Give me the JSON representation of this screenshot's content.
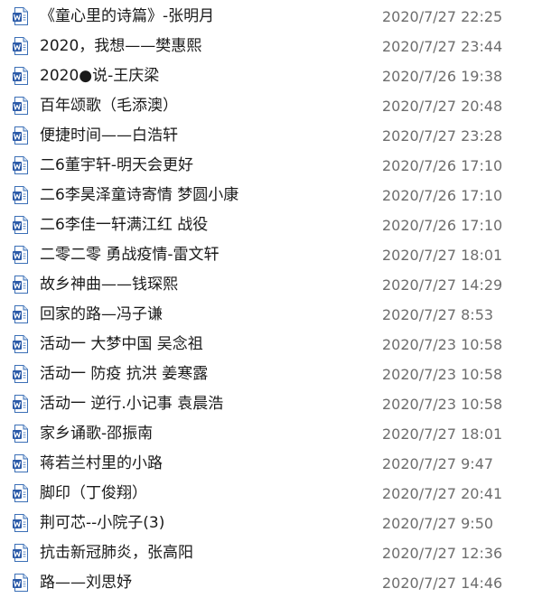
{
  "files": [
    {
      "name": "《童心里的诗篇》-张明月",
      "modified": "2020/7/27 22:25",
      "icon": "word-document-icon"
    },
    {
      "name": "2020，我想——樊惠熙",
      "modified": "2020/7/27 23:44",
      "icon": "word-document-icon"
    },
    {
      "name": "2020●说-王庆梁",
      "modified": "2020/7/26 19:38",
      "icon": "word-document-icon"
    },
    {
      "name": "百年颂歌（毛添澳）",
      "modified": "2020/7/27 20:48",
      "icon": "word-document-icon"
    },
    {
      "name": "便捷时间——白浩轩",
      "modified": "2020/7/27 23:28",
      "icon": "word-document-icon"
    },
    {
      "name": "二6董宇轩-明天会更好",
      "modified": "2020/7/26 17:10",
      "icon": "word-document-icon"
    },
    {
      "name": "二6李昊泽童诗寄情 梦圆小康",
      "modified": "2020/7/26 17:10",
      "icon": "word-document-icon"
    },
    {
      "name": "二6李佳一轩满江红 战役",
      "modified": "2020/7/26 17:10",
      "icon": "word-document-icon"
    },
    {
      "name": "二零二零  勇战疫情-雷文轩",
      "modified": "2020/7/27 18:01",
      "icon": "word-document-icon"
    },
    {
      "name": "故乡神曲——钱琛熙",
      "modified": "2020/7/27 14:29",
      "icon": "word-document-icon"
    },
    {
      "name": "回家的路—冯子谦",
      "modified": "2020/7/27 8:53",
      "icon": "word-document-icon"
    },
    {
      "name": "活动一 大梦中国 吴念祖",
      "modified": "2020/7/23 10:58",
      "icon": "word-document-icon"
    },
    {
      "name": "活动一 防疫  抗洪 姜寒露",
      "modified": "2020/7/23 10:58",
      "icon": "word-document-icon"
    },
    {
      "name": "活动一 逆行.小记事 袁晨浩",
      "modified": "2020/7/23 10:58",
      "icon": "word-document-icon"
    },
    {
      "name": "家乡诵歌-邵振南",
      "modified": "2020/7/27 18:01",
      "icon": "word-document-icon"
    },
    {
      "name": "蒋若兰村里的小路",
      "modified": "2020/7/27 9:47",
      "icon": "word-document-icon"
    },
    {
      "name": "脚印（丁俊翔）",
      "modified": "2020/7/27 20:41",
      "icon": "word-document-icon"
    },
    {
      "name": "荆可芯--小院子(3)",
      "modified": "2020/7/27 9:50",
      "icon": "word-document-icon"
    },
    {
      "name": "抗击新冠肺炎，张高阳",
      "modified": "2020/7/27 12:36",
      "icon": "word-document-icon"
    },
    {
      "name": "路——刘思妤",
      "modified": "2020/7/27 14:46",
      "icon": "word-document-icon"
    }
  ],
  "colors": {
    "icon_border": "#3b6fb6",
    "icon_fill": "#ffffff",
    "icon_w": "#2b5aa8",
    "name_text": "#1a1a1a",
    "date_text": "#6d6d6d"
  }
}
